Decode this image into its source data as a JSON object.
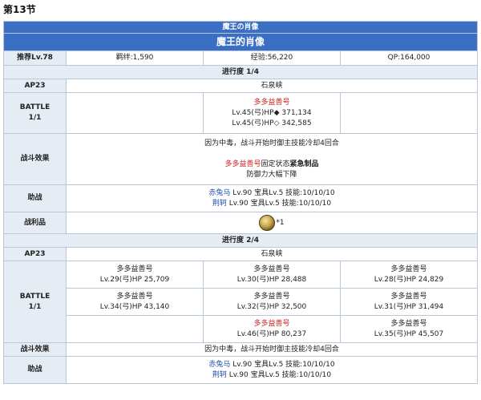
{
  "section": {
    "title": "第13节"
  },
  "header": {
    "subtitle": "魔王の肖像",
    "title": "魔王的肖像"
  },
  "info": {
    "level_label": "推荐Lv.78",
    "bond": "羁绊:1,590",
    "exp": "经验:56,220",
    "qp": "QP:164,000"
  },
  "progress1": {
    "label": "进行度 1/4",
    "ap": "AP23",
    "location": "石泉峡",
    "battle_label": "BATTLE",
    "battle_num": "1/1",
    "enemy_name": "多多益善号",
    "enemy_line1": "Lv.45(弓)HP◆ 371,134",
    "enemy_line2": "Lv.45(弓)HP◇ 342,585",
    "effect_label": "战斗效果",
    "effect_line1": "因为中毒，战斗开始时御主技能冷却4回合",
    "effect_name": "多多益善号",
    "effect_text2a": "固定状态",
    "effect_text2b": "紧急制品",
    "effect_line3": "防御力大幅下降",
    "support_label": "助战",
    "support1_name": "赤兔马",
    "support1_rest": " Lv.90 宝具Lv.5 技能:10/10/10",
    "support2_name": "荆轲",
    "support2_rest": " Lv.90 宝具Lv.5 技能:10/10/10",
    "drop_label": "战利品",
    "drop_count": "*1"
  },
  "progress2": {
    "label": "进行度 2/4",
    "ap": "AP23",
    "location": "石泉峡",
    "battle_label": "BATTLE",
    "battle_num": "1/1",
    "rows": [
      [
        {
          "name": "多多益善号",
          "stats": "Lv.29(弓)HP 25,709",
          "red": false
        },
        {
          "name": "多多益善号",
          "stats": "Lv.30(弓)HP 28,488",
          "red": false
        },
        {
          "name": "多多益善号",
          "stats": "Lv.28(弓)HP 24,829",
          "red": false
        }
      ],
      [
        {
          "name": "多多益善号",
          "stats": "Lv.34(弓)HP 43,140",
          "red": false
        },
        {
          "name": "多多益善号",
          "stats": "Lv.32(弓)HP 32,500",
          "red": false
        },
        {
          "name": "多多益善号",
          "stats": "Lv.31(弓)HP 31,494",
          "red": false
        }
      ],
      [
        {
          "name": "",
          "stats": "",
          "red": false
        },
        {
          "name": "多多益善号",
          "stats": "Lv.46(弓)HP 80,237",
          "red": true
        },
        {
          "name": "多多益善号",
          "stats": "Lv.35(弓)HP 45,507",
          "red": false
        }
      ]
    ],
    "effect_label": "战斗效果",
    "effect_line1": "因为中毒，战斗开始时御主技能冷却4回合",
    "support_label": "助战",
    "support1_name": "赤兔马",
    "support1_rest": " Lv.90 宝具Lv.5 技能:10/10/10",
    "support2_name": "荆轲",
    "support2_rest": " Lv.90 宝具Lv.5 技能:10/10/10"
  },
  "icons": {
    "drop": "golden-relic-icon"
  }
}
